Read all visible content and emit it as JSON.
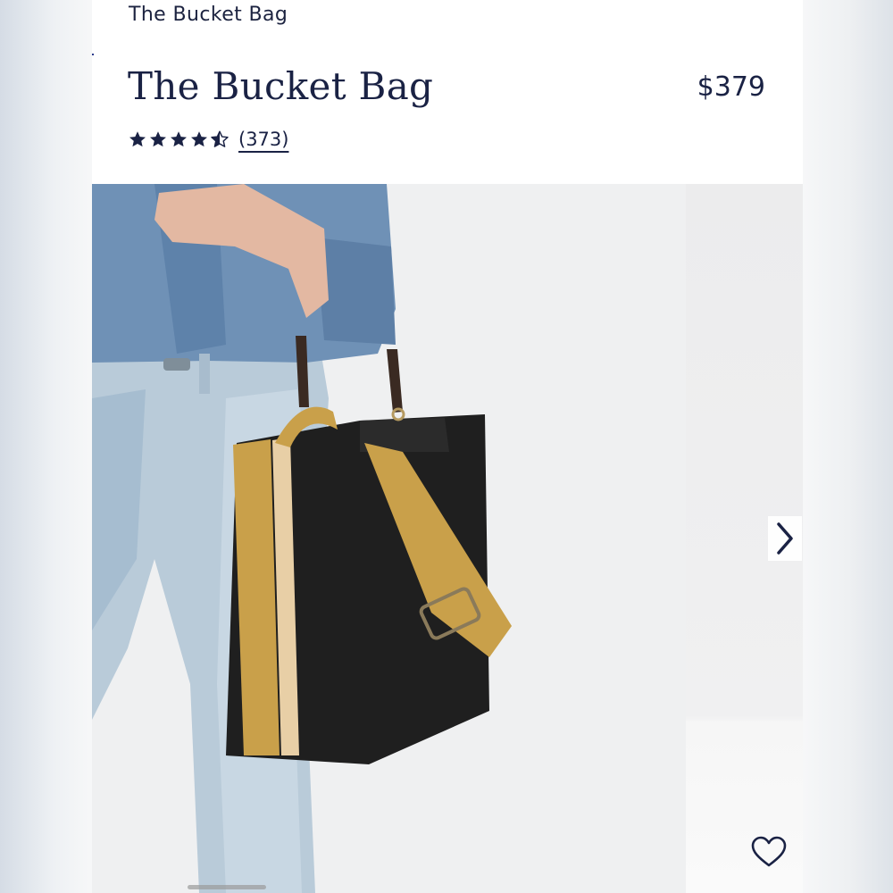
{
  "nav": {
    "title": "The Bucket Bag"
  },
  "product": {
    "title": "The Bucket Bag",
    "price": "$379",
    "rating": 4.5,
    "rating_max": 5,
    "review_count_label": "(373)"
  },
  "gallery": {
    "main_image": "model-wearing-bucket-bag",
    "next_image": "bucket-bag-product-shot",
    "next_icon": "chevron-right-icon",
    "favorite_icon": "heart-icon"
  },
  "colors": {
    "brand_navy": "#1a2244",
    "bag_black": "#1f1f1f",
    "strap_mustard": "#c9a04a",
    "denim": "#6f91b6"
  }
}
